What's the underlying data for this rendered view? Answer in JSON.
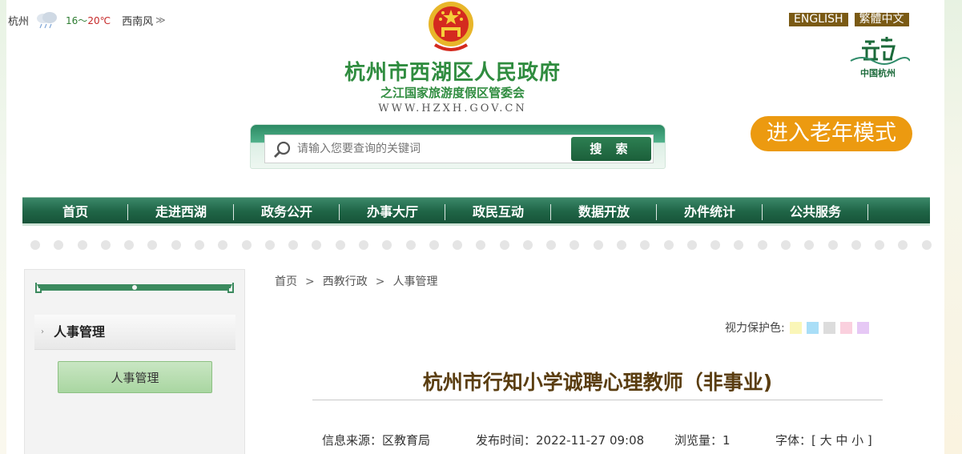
{
  "weather": {
    "city": "杭州",
    "temp_low": "16",
    "temp_sep": "～",
    "temp_high": "20℃",
    "wind": "西南风",
    "more": "≫"
  },
  "lang": {
    "english": "ENGLISH",
    "traditional": "繁體中文"
  },
  "hangzhou_logo": {
    "text": "中国杭州"
  },
  "site": {
    "title": "杭州市西湖区人民政府",
    "subtitle": "之江国家旅游度假区管委会",
    "url": "WWW.HZXH.GOV.CN"
  },
  "search": {
    "placeholder": "请输入您要查询的关键词",
    "button": "搜 索"
  },
  "elder_mode": "进入老年模式",
  "nav": [
    "首页",
    "走进西湖",
    "政务公开",
    "办事大厅",
    "政民互动",
    "数据开放",
    "办件统计",
    "公共服务"
  ],
  "sidebar": {
    "header": "人事管理",
    "item": "人事管理"
  },
  "breadcrumb": [
    "首页",
    "西教行政",
    "人事管理"
  ],
  "breadcrumb_sep": ">",
  "eye_care": {
    "label": "视力保护色:",
    "colors": [
      "#faf6b8",
      "#a9def7",
      "#dcdcdc",
      "#fad0de",
      "#e6c8f5"
    ]
  },
  "article": {
    "title": "杭州市行知小学诚聘心理教师（非事业)",
    "source": "信息来源：区教育局",
    "published": "发布时间：2022-11-27 09:08",
    "views": "浏览量：1",
    "font": "字体：[ 大 中 小 ]"
  },
  "colors": {
    "green": "#2f8c3f",
    "nav_green": "#1f6546",
    "gold": "#7a5a14",
    "orange": "#ec9a10"
  }
}
